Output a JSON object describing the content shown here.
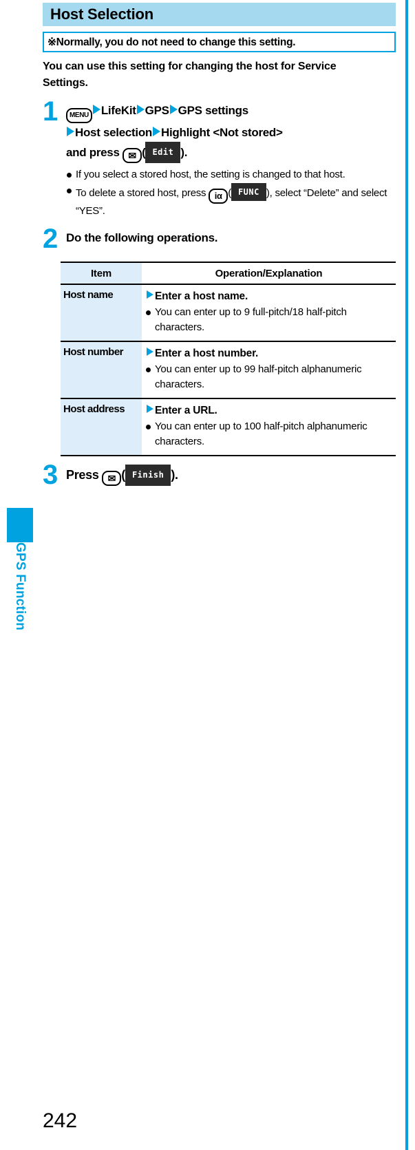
{
  "sidebar": {
    "chapter_label": "GPS Function",
    "tab_color": "#00a3e0"
  },
  "section": {
    "title": "Host Selection",
    "header_bg": "#a5d9ef"
  },
  "note": {
    "text": "※Normally, you do not need to change this setting.",
    "border_color": "#00a3e0"
  },
  "intro": "You can use this setting for changing the host for Service Settings.",
  "steps": [
    {
      "number": "1",
      "head": {
        "key_menu": "MENU",
        "item1": "LifeKit",
        "item2": "GPS",
        "item3": "GPS settings",
        "item4": "Host selection",
        "item5": "Highlight <Not stored>",
        "press_text": "and press",
        "key_mail": "✉",
        "softkey": "Edit",
        "tail": ")."
      },
      "bullets": [
        "If you select a stored host, the setting is changed to that host.",
        {
          "pre": "To delete a stored host, press",
          "key": "iα",
          "softkey": "FUNC",
          "post": "), select “Delete” and select “YES”."
        }
      ]
    },
    {
      "number": "2",
      "head": "Do the following operations."
    },
    {
      "number": "3",
      "head": {
        "press_text": "Press",
        "key_mail": "✉",
        "softkey": "Finish",
        "tail": ")."
      }
    }
  ],
  "table": {
    "headers": {
      "item": "Item",
      "operation": "Operation/Explanation"
    },
    "rows": [
      {
        "item": "Host name",
        "op_head": "Enter a host name.",
        "op_bullet": "You can enter up to 9 full-pitch/18 half-pitch characters."
      },
      {
        "item": "Host number",
        "op_head": "Enter a host number.",
        "op_bullet": "You can enter up to 99 half-pitch alphanumeric characters."
      },
      {
        "item": "Host address",
        "op_head": "Enter a URL.",
        "op_bullet": "You can enter up to 100 half-pitch alphanumeric characters."
      }
    ],
    "item_col_bg": "#ddeefa"
  },
  "page_number": "242",
  "accent_color": "#00a3e0"
}
